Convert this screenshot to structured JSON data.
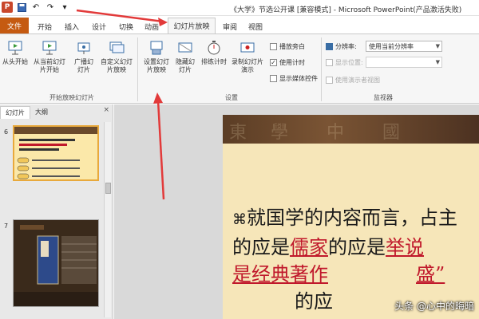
{
  "window": {
    "title": "《大学》节选公开课 [兼容模式] - Microsoft PowerPoint(产品激活失败)"
  },
  "qat": {
    "logo": "P",
    "undo": "↶",
    "redo": "↷",
    "more": "▾"
  },
  "tabs": {
    "file": "文件",
    "home": "开始",
    "insert": "插入",
    "design": "设计",
    "transitions": "切换",
    "animations": "动画",
    "slideshow": "幻灯片放映",
    "review": "审阅",
    "view": "视图"
  },
  "ribbon": {
    "start_group": {
      "from_beginning": "从头开始",
      "from_current": "从当前幻灯片开始",
      "broadcast": "广播幻灯片",
      "custom": "自定义幻灯片放映",
      "label": "开始放映幻灯片"
    },
    "setup_group": {
      "setup": "设置幻灯片放映",
      "hide": "隐藏幻灯片",
      "rehearse": "排练计时",
      "record": "录制幻灯片演示",
      "play_narrations": "播放旁白",
      "use_timings": "使用计时",
      "show_media": "显示媒体控件",
      "label": "设置"
    },
    "monitor_group": {
      "resolution_label": "分辨率:",
      "resolution_value": "使用当前分辨率",
      "show_on_label": "显示位置:",
      "presenter_view": "使用演示者视图",
      "label": "监视器"
    }
  },
  "leftpane": {
    "tab_slides": "幻灯片",
    "tab_outline": "大纲",
    "close": "×",
    "slide6_num": "6",
    "slide7_num": "7"
  },
  "slide": {
    "line1_prefix": "⌘",
    "line1_text": "就国学的内容而言，占主",
    "line2_a": "的应是",
    "line2_red1": "儒家",
    "line2_b": "的应是",
    "line2_red2": "举说",
    "line3_red1": "是经典著作",
    "line3_red2": "盛”",
    "line4": "的应"
  },
  "watermark": "头条 @心中的晦暗",
  "colors": {
    "file_tab": "#c55a11",
    "slide_bg": "#f6e6b9",
    "accent_red": "#c0182b",
    "arrow": "#e23a3a"
  }
}
